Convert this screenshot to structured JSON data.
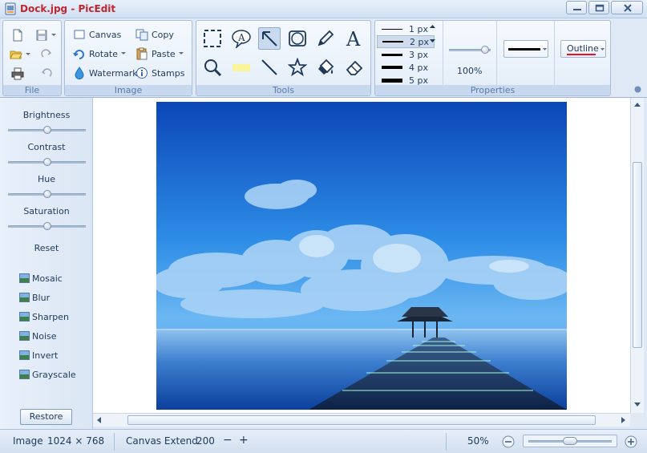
{
  "window": {
    "title": "Dock.jpg - PicEdit"
  },
  "ribbon": {
    "groups": {
      "file": "File",
      "image": "Image",
      "tools": "Tools",
      "properties": "Properties"
    },
    "image": {
      "canvas": "Canvas",
      "copy": "Copy",
      "rotate": "Rotate",
      "paste": "Paste",
      "watermark": "Watermark",
      "stamps": "Stamps"
    },
    "line_widths": [
      "1 px",
      "2 px",
      "3 px",
      "4 px",
      "5 px"
    ],
    "selected_line_width": "2 px",
    "opacity": "100%",
    "outline_label": "Outline",
    "colors": {
      "outline_underline": "#e81123",
      "accent": "#c0272d"
    }
  },
  "adjustments": {
    "labels": [
      "Brightness",
      "Contrast",
      "Hue",
      "Saturation"
    ],
    "levels": [
      0.5,
      0.5,
      0.5,
      0.5
    ],
    "reset": "Reset"
  },
  "effects": [
    "Mosaic",
    "Blur",
    "Sharpen",
    "Noise",
    "Invert",
    "Grayscale"
  ],
  "restore_label": "Restore",
  "status": {
    "image_label": "Image",
    "image_size": "1024 × 768",
    "canvas_extend_label": "Canvas Extend",
    "canvas_extend_value": "200",
    "minus": "−",
    "plus": "+",
    "zoom": "50%",
    "zoom_level": 0.5
  }
}
